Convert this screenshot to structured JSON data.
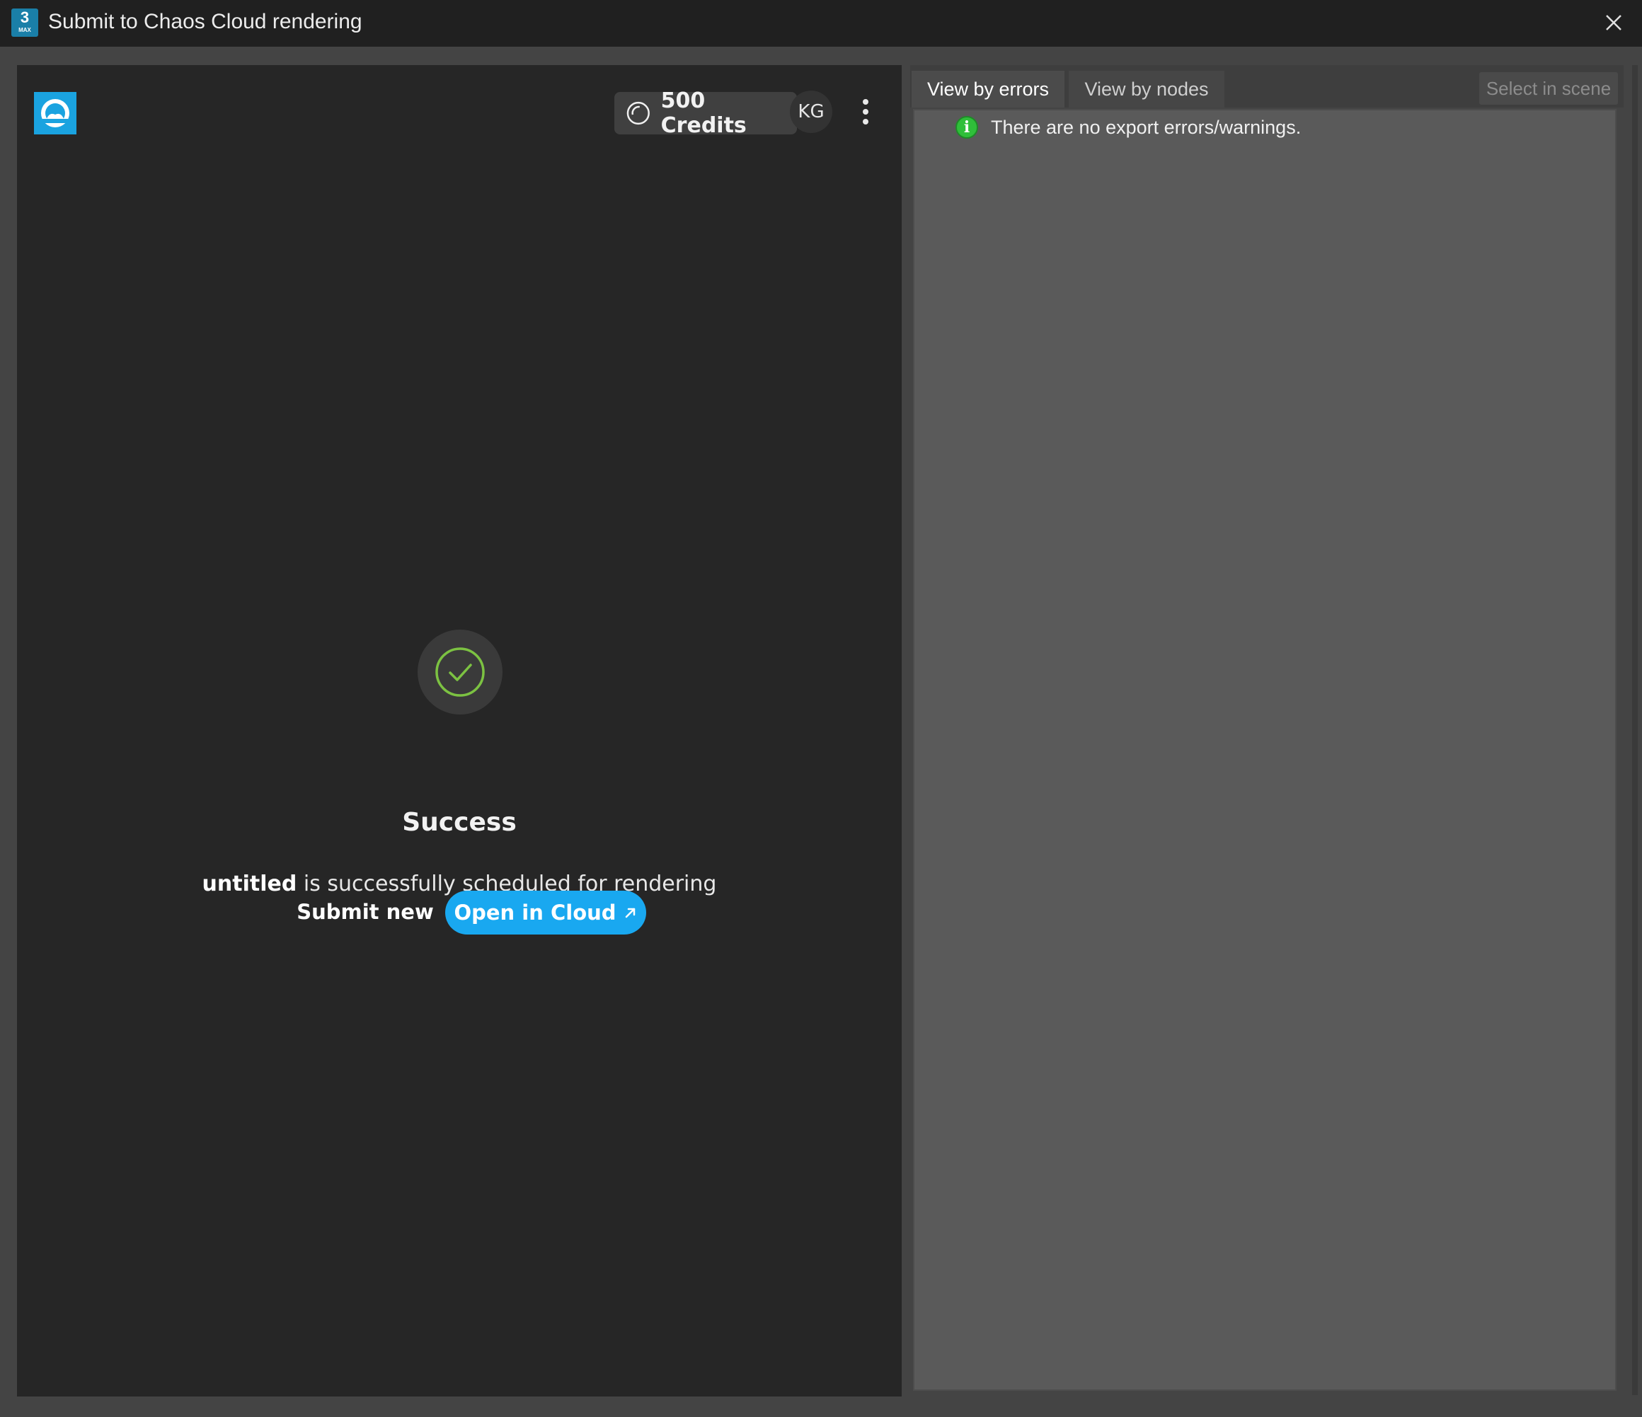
{
  "window": {
    "title": "Submit to Chaos Cloud rendering",
    "app_icon_number": "3",
    "app_icon_sub": "MAX"
  },
  "header": {
    "credits_label": "500 Credits",
    "avatar_initials": "KG"
  },
  "status": {
    "title": "Success",
    "project_name": "untitled",
    "message": "is successfully scheduled for rendering",
    "submit_new_label": "Submit new",
    "open_cloud_label": "Open in Cloud"
  },
  "errors_panel": {
    "tabs": [
      {
        "label": "View by errors",
        "active": true
      },
      {
        "label": "View by nodes",
        "active": false
      }
    ],
    "select_in_scene_label": "Select in scene",
    "info_message": "There are no export errors/warnings."
  },
  "colors": {
    "accent": "#19a8f0",
    "success": "#7cc242",
    "info": "#2fbf3a"
  }
}
